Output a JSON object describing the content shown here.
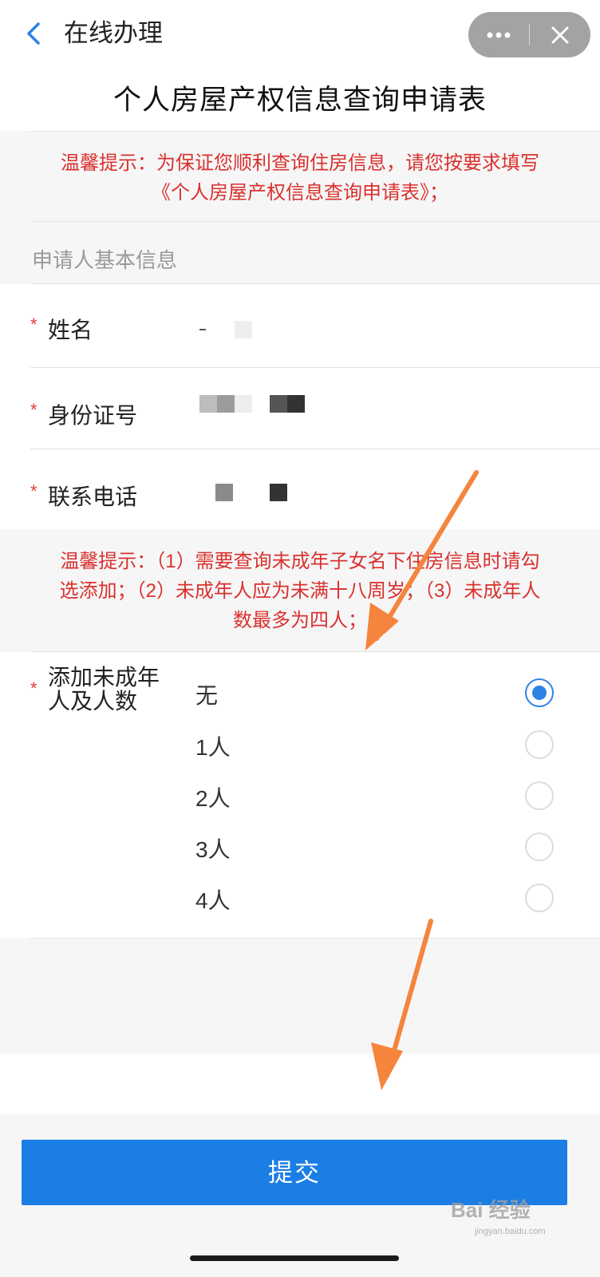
{
  "header": {
    "back_icon": "chevron-left-icon",
    "title": "在线办理",
    "more_icon": "more-dots-icon",
    "close_icon": "close-icon"
  },
  "page_title": "个人房屋产权信息查询申请表",
  "tip1": {
    "line1": "温馨提示：为保证您顺利查询住房信息，请您按要求填写",
    "line2": "《个人房屋产权信息查询申请表》；"
  },
  "section_title": "申请人基本信息",
  "fields": {
    "name_label": "姓名",
    "id_label": "身份证号",
    "phone_label": "联系电话",
    "required_mark": "*"
  },
  "tip2": {
    "line1": "温馨提示：（1）需要查询未成年子女名下住房信息时请勾",
    "line2": "选添加；（2）未成年人应为未满十八周岁；（3）未成年人",
    "line3": "数最多为四人；"
  },
  "minors": {
    "label_line1": "添加未成年",
    "label_line2": "人及人数",
    "options": [
      "无",
      "1人",
      "2人",
      "3人",
      "4人"
    ],
    "selected": "无"
  },
  "submit_label": "提交",
  "watermark": {
    "text": "Bai 经验",
    "sub": "jingyan.baidu.com"
  },
  "colors": {
    "accent_blue": "#1b7ee5",
    "tip_red": "#d9312f",
    "annotation_arrow": "#f5843d"
  }
}
